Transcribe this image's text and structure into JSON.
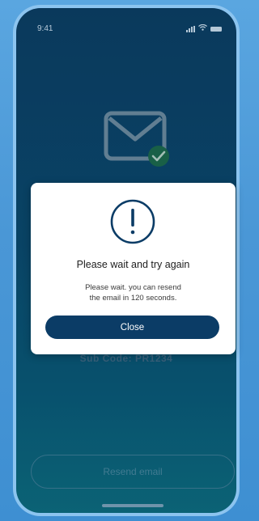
{
  "status_bar": {
    "time": "9:41",
    "icons": [
      "signal-icon",
      "wifi-icon",
      "battery-icon"
    ]
  },
  "background_screen": {
    "icon": "mail-check-icon",
    "obscured_text": "Sub Code: PR1234",
    "resend_label": "Resend email"
  },
  "dialog": {
    "icon": "alert-icon",
    "title": "Please wait and try again",
    "message_line1": "Please wait. you can resend",
    "message_line2": "the email in 120 seconds.",
    "close_label": "Close"
  },
  "colors": {
    "primary": "#0b3c66",
    "screen_top": "#0c3f64",
    "screen_bottom": "#0d6e80",
    "success": "#1d6b4c",
    "outer_background": "#4a97d6"
  }
}
